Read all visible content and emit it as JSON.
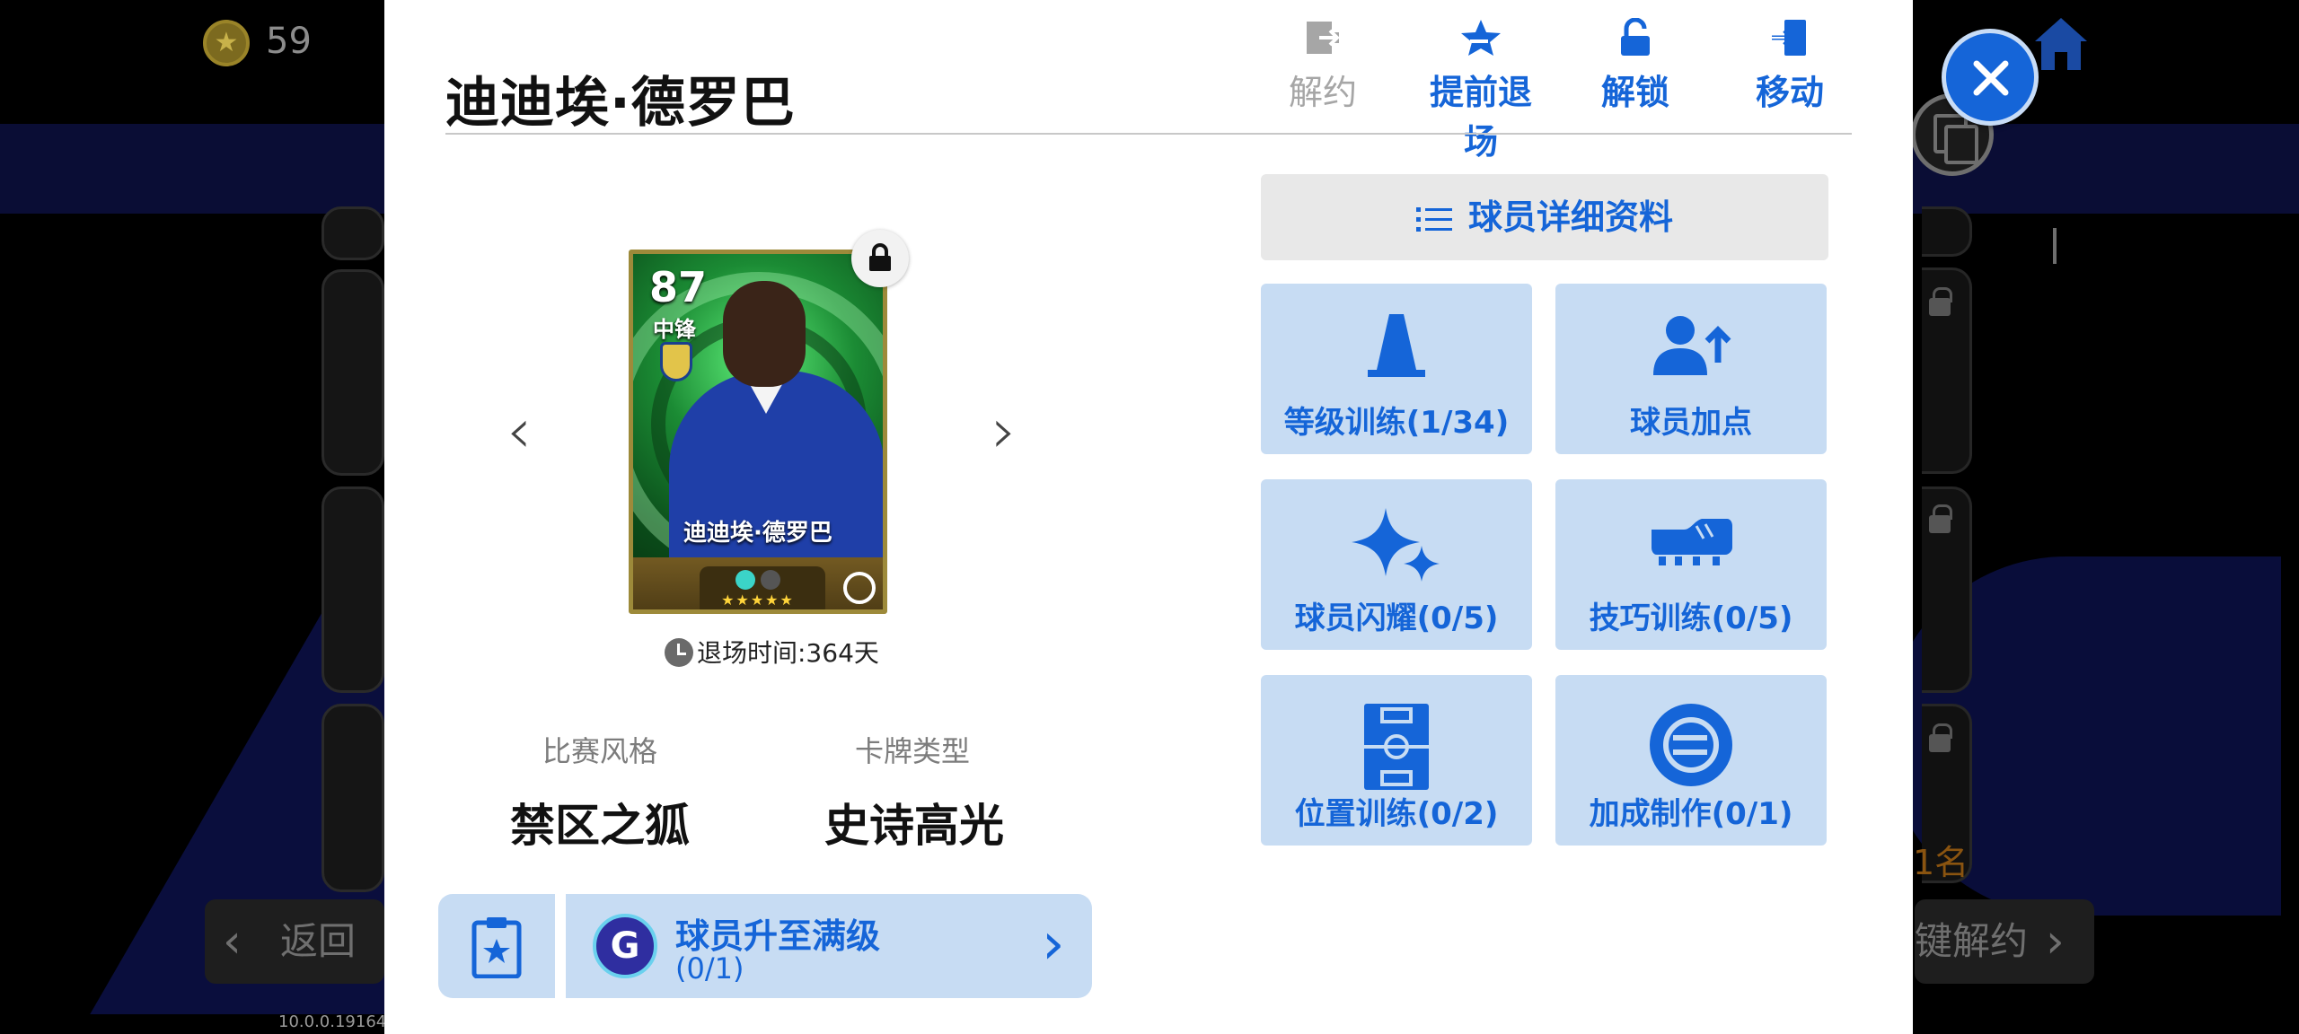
{
  "app": {
    "coins": "59",
    "version": "10.0.0.191647",
    "background_back": "返回",
    "background_unsign_all": "键解约",
    "background_rank_text": "1名"
  },
  "player": {
    "name": "迪迪埃·德罗巴",
    "rating": "87",
    "position": "中锋",
    "retire_time": "退场时间:364天",
    "play_style_label": "比赛风格",
    "play_style": "禁区之狐",
    "card_type_label": "卡牌类型",
    "card_type": "史诗高光"
  },
  "top_actions": {
    "unsign": "解约",
    "early_exit": "提前退场",
    "unlock": "解锁",
    "move": "移动"
  },
  "details_button": "球员详细资料",
  "tiles": [
    {
      "label": "等级训练(1/34)",
      "icon": "cone-icon"
    },
    {
      "label": "球员加点",
      "icon": "person-plus-icon"
    },
    {
      "label": "球员闪耀(0/5)",
      "icon": "sparkle-icon"
    },
    {
      "label": "技巧训练(0/5)",
      "icon": "boot-icon"
    },
    {
      "label": "位置训练(0/2)",
      "icon": "pitch-icon"
    },
    {
      "label": "加成制作(0/1)",
      "icon": "efootball-icon"
    }
  ],
  "upgrade": {
    "title": "球员升至满级",
    "progress": "(0/1)",
    "coin_letter": "G"
  },
  "colors": {
    "accent": "#1565d8",
    "tile_bg": "#c7dcf3",
    "disabled": "#a6a6a6"
  }
}
